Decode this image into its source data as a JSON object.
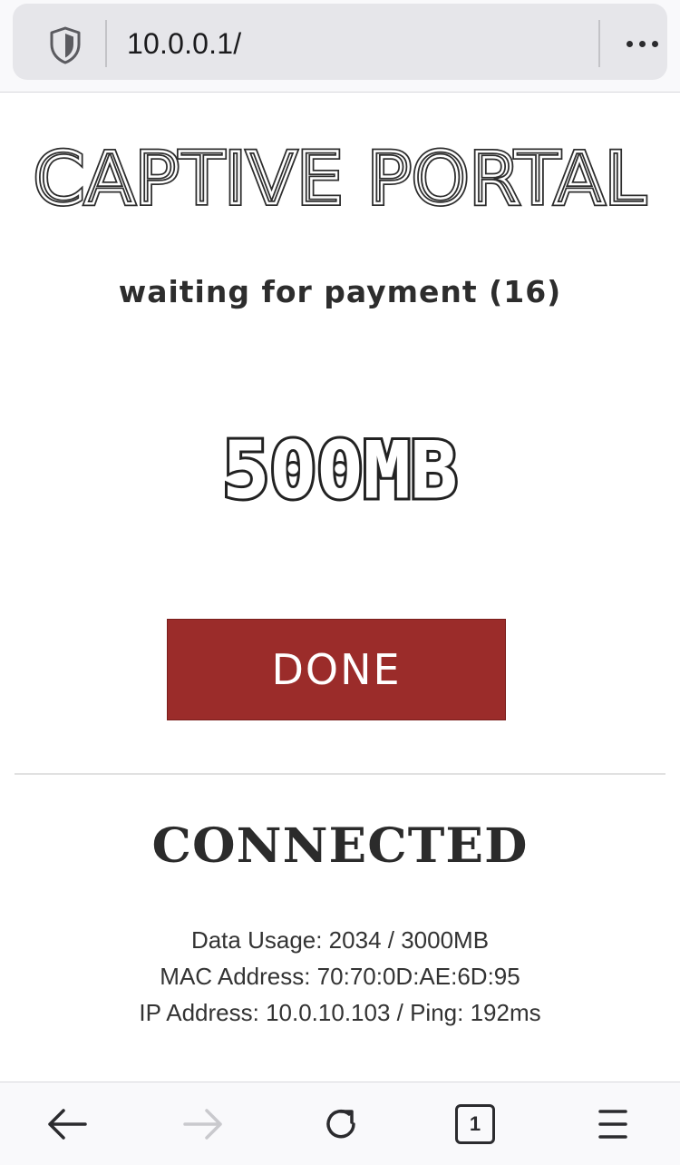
{
  "browser": {
    "url": "10.0.0.1/",
    "tab_count": "1"
  },
  "page": {
    "title": "CAPTIVE PORTAL",
    "status": "waiting for payment (16)",
    "package": "500MB",
    "done_label": "DONE",
    "connection_state": "CONNECTED",
    "data_usage": "Data Usage: 2034 / 3000MB",
    "mac_address": "MAC Address: 70:70:0D:AE:6D:95",
    "ip_ping": "IP Address: 10.0.10.103 / Ping: 192ms"
  },
  "colors": {
    "accent_button": "#9b2c2a",
    "text_dark": "#2b2b2b"
  },
  "icons": {
    "toolbar": [
      "shield-icon",
      "more-menu-icon"
    ],
    "bottom": [
      "back-arrow-icon",
      "forward-arrow-icon",
      "reload-icon",
      "tabs-icon",
      "hamburger-menu-icon"
    ]
  }
}
